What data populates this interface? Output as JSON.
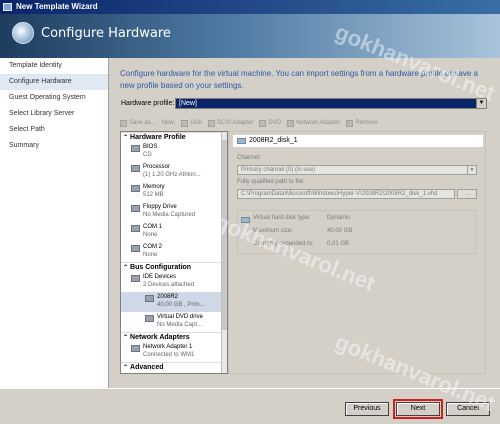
{
  "window": {
    "title": "New Template Wizard"
  },
  "header": {
    "title": "Configure Hardware"
  },
  "nav": {
    "items": [
      "Template Identity",
      "Configure Hardware",
      "Guest Operating System",
      "Select Library Server",
      "Select Path",
      "Summary"
    ],
    "active_index": 1
  },
  "description": "Configure hardware for the virtual machine. You can import settings from a hardware profile or save a new profile based on your settings.",
  "hardware_profile": {
    "label": "Hardware profile:",
    "value": "[New]"
  },
  "toolbar": {
    "items": [
      "Save as...",
      "New:",
      "Disk",
      "SCSI Adapter",
      "DVD",
      "Network Adapter",
      "Remove"
    ]
  },
  "tree": {
    "hardware_profile_label": "Hardware Profile",
    "hardware_items": [
      {
        "name": "BIOS",
        "detail": "CD"
      },
      {
        "name": "Processor",
        "detail": "(1) 1.20 GHz Athlon..."
      },
      {
        "name": "Memory",
        "detail": "512 MB"
      },
      {
        "name": "Floppy Drive",
        "detail": "No Media Captured"
      },
      {
        "name": "COM 1",
        "detail": "None"
      },
      {
        "name": "COM 2",
        "detail": "None"
      }
    ],
    "bus_label": "Bus Configuration",
    "ide": {
      "name": "IDE Devices",
      "detail": "2 Devices attached"
    },
    "disk": {
      "name": "2008R2",
      "detail": "40,00 GB , Prim..."
    },
    "dvd": {
      "name": "Virtual DVD drive",
      "detail": "No Media Capt..."
    },
    "network_label": "Network Adapters",
    "net": {
      "name": "Network Adapter 1",
      "detail": "Connected to WM1"
    },
    "advanced_label": "Advanced"
  },
  "detail": {
    "title": "2008R2_disk_1",
    "channel_label": "Channel:",
    "channel_value": "Primary channel (0) (in use)",
    "path_label": "Fully qualified path to file:",
    "path_value": "C:\\ProgramData\\Microsoft\\Windows\\Hyper-V\\2008R2\\2008R2_disk_1.vhd",
    "browse": "...",
    "disk_type_label": "Virtual hard disk type:",
    "disk_type_value": "Dynamic",
    "max_size_label": "Maximum size:",
    "max_size_value": "40,00 GB",
    "expanded_label": "Currently expanded to:",
    "expanded_value": "0,01 GB"
  },
  "buttons": {
    "previous": "Previous",
    "next": "Next",
    "cancel": "Cancel"
  },
  "watermark": "gokhanvarol.net"
}
